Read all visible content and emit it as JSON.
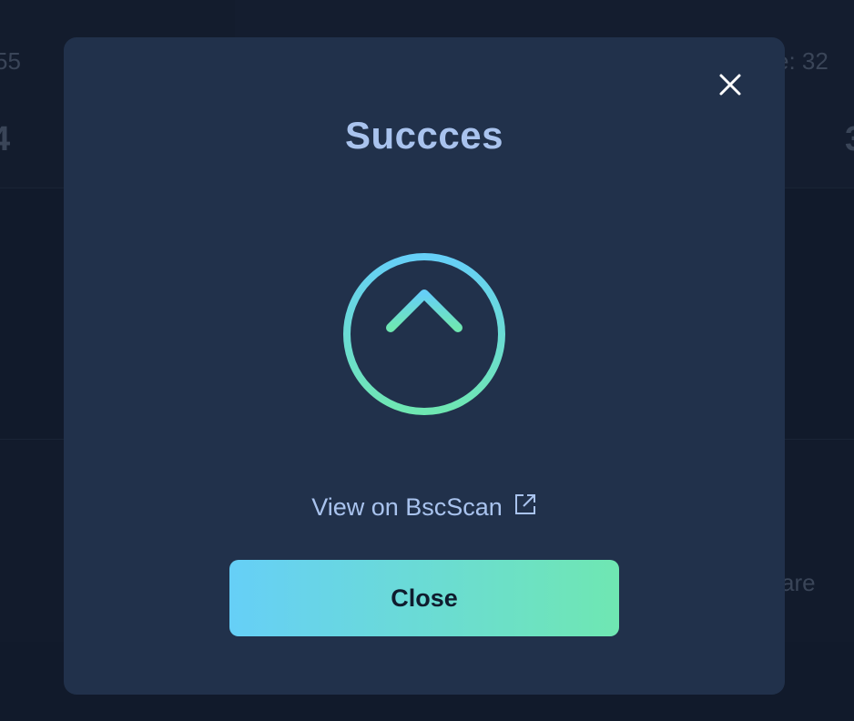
{
  "background": {
    "top_left_number": "55",
    "top_left_big": "4",
    "top_right_label": "e:  32",
    "top_right_big": "3",
    "lower_right_text": "are"
  },
  "modal": {
    "title": "Succces",
    "close_icon": "close-icon",
    "status_icon": "upload-arrow-circle-icon",
    "view_link_label": "View on BscScan",
    "view_link_icon": "external-link-icon",
    "close_button_label": "Close"
  },
  "colors": {
    "modal_bg": "#21314b",
    "title": "#a9c3ee",
    "gradient_start": "#66cff7",
    "gradient_end": "#6fe7b2"
  }
}
